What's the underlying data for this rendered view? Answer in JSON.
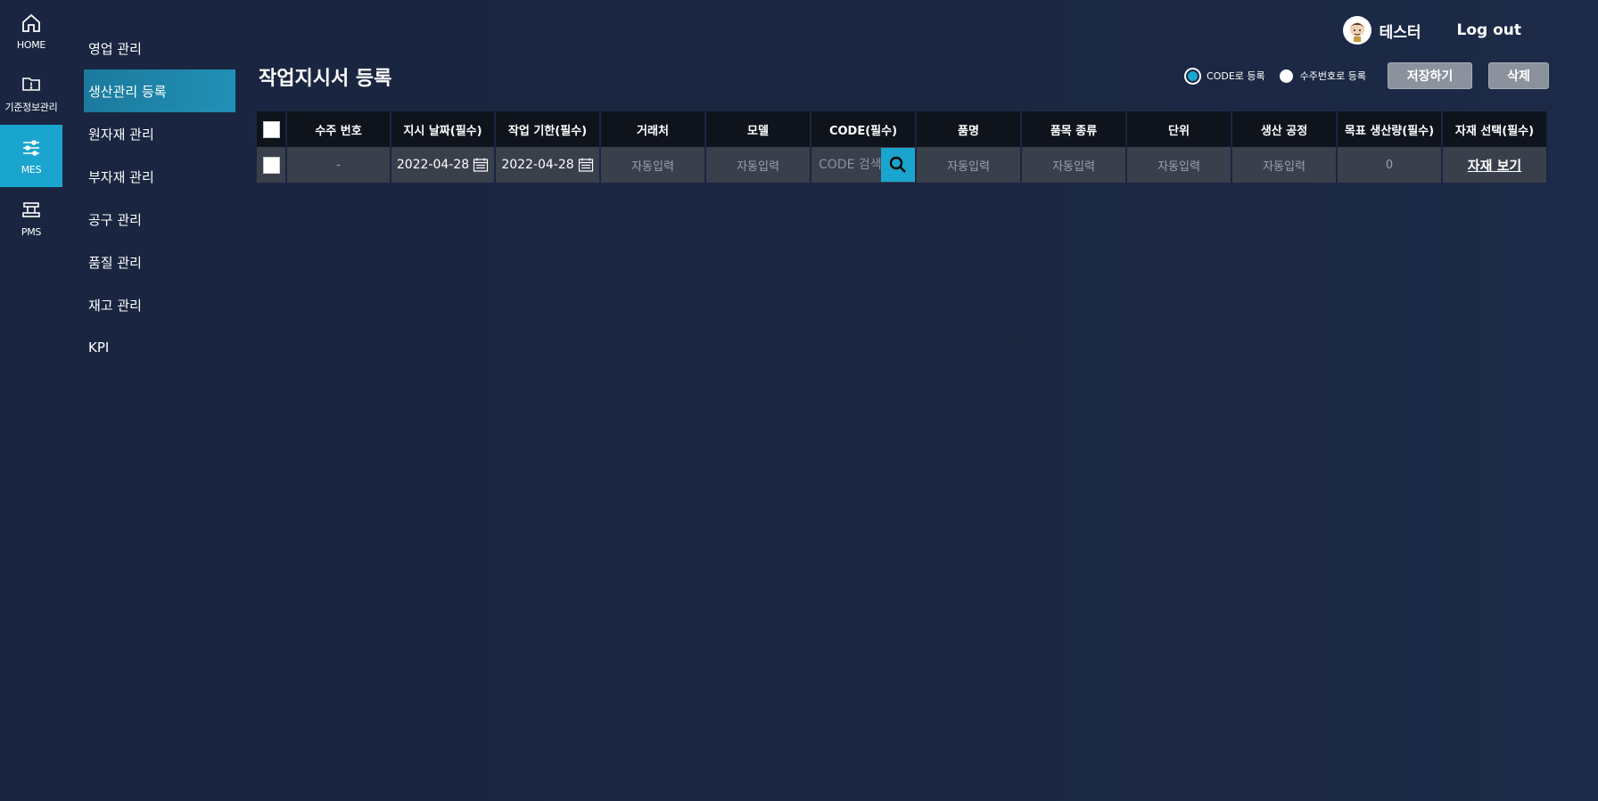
{
  "rail": {
    "items": [
      {
        "label": "HOME",
        "icon": "home-icon"
      },
      {
        "label": "기준정보관리",
        "icon": "info-folder-icon"
      },
      {
        "label": "MES",
        "icon": "sliders-icon"
      },
      {
        "label": "PMS",
        "icon": "machine-icon"
      }
    ],
    "active_color": "#1aa5cf"
  },
  "menu": {
    "items": [
      {
        "label": "영업 관리"
      },
      {
        "label": "생산관리 등록"
      },
      {
        "label": "원자재 관리"
      },
      {
        "label": "부자재 관리"
      },
      {
        "label": "공구 관리"
      },
      {
        "label": "품질 관리"
      },
      {
        "label": "재고 관리"
      },
      {
        "label": "KPI"
      }
    ],
    "active_index": 1
  },
  "topbar": {
    "username": "테스터",
    "logout_label": "Log out"
  },
  "page": {
    "title": "작업지시서 등록"
  },
  "actions": {
    "radio_code_label": "CODE로 등록",
    "radio_order_label": "수주번호로 등록",
    "radio_selected": "code",
    "save_label": "저장하기",
    "delete_label": "삭제"
  },
  "table": {
    "headers": [
      "",
      "수주 번호",
      "지시 날짜(필수)",
      "작업 기한(필수)",
      "거래처",
      "모델",
      "CODE(필수)",
      "품명",
      "품목 종류",
      "단위",
      "생산 공정",
      "목표 생산량(필수)",
      "자재 선택(필수)"
    ],
    "row": {
      "order_no": "-",
      "instruction_date": "2022-04-28",
      "deadline": "2022-04-28",
      "client": "자동입력",
      "model": "자동입력",
      "code_placeholder": "CODE 검색",
      "product_name": "자동입력",
      "item_type": "자동입력",
      "unit": "자동입력",
      "process": "자동입력",
      "target_qty": "0",
      "material_link": "자재 보기"
    }
  }
}
